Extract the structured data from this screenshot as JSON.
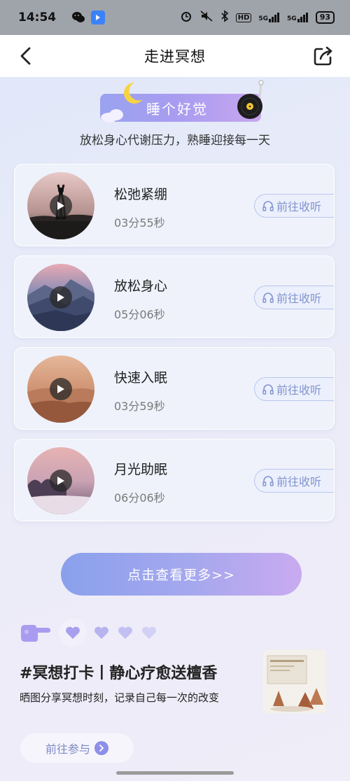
{
  "status_bar": {
    "time": "14:54",
    "net_5g_a": "5G",
    "net_5g_b": "5G",
    "hd": "HD",
    "battery": "93"
  },
  "nav": {
    "title": "走进冥想"
  },
  "banner": {
    "title": "睡个好觉",
    "subtitle": "放松身心代谢压力，熟睡迎接每一天"
  },
  "tracks": [
    {
      "name": "松弛紧绷",
      "duration": "03分55秒",
      "action": "前往收听"
    },
    {
      "name": "放松身心",
      "duration": "05分06秒",
      "action": "前往收听"
    },
    {
      "name": "快速入眠",
      "duration": "03分59秒",
      "action": "前往收听"
    },
    {
      "name": "月光助眠",
      "duration": "06分06秒",
      "action": "前往收听"
    }
  ],
  "more_button": "点击查看更多>>",
  "checkin": {
    "title": "#冥想打卡丨静心疗愈送檀香",
    "description": "晒图分享冥想时刻，记录自己每一次的改变",
    "join_button": "前往参与"
  },
  "colors": {
    "accent": "#8aa0ec",
    "listen_text": "#8193cf"
  }
}
